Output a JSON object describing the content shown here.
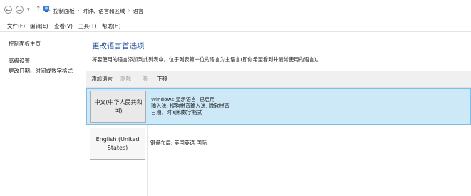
{
  "address_bar": {
    "crumbs": [
      "控制面板",
      "时钟、语言和区域",
      "语言"
    ]
  },
  "menu": {
    "items": [
      "文件(F)",
      "编辑(E)",
      "查看(V)",
      "工具(T)",
      "帮助(H)"
    ]
  },
  "left_nav": {
    "items": [
      "控制面板主页",
      "高级设置",
      "更改日期、时间或数字格式"
    ]
  },
  "main": {
    "title": "更改语言首选项",
    "description": "将要使用的语言添加到此列表中。位于列表第一位的语言为主语言(即你希望看到并最常使用的语言)。",
    "toolbar": {
      "add": "添加语言",
      "remove": "删除",
      "up": "上移",
      "down": "下移"
    },
    "languages": [
      {
        "name": "中文(中华人民共和国)",
        "details": [
          "Windows 显示语言: 已启用",
          "输入法: 搜狗拼音输入法, 微软拼音",
          "日期、时间和数字格式"
        ]
      },
      {
        "name": "English (United States)",
        "details": [
          "键盘布局: 美国英语-国际"
        ]
      }
    ]
  }
}
